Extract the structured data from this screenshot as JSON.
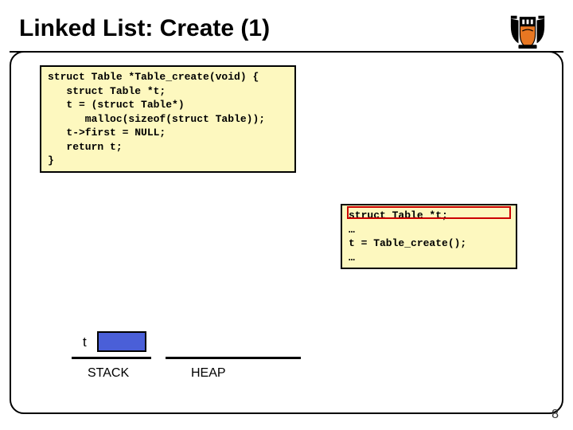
{
  "title": "Linked List: Create (1)",
  "code_main": "struct Table *Table_create(void) {\n   struct Table *t;\n   t = (struct Table*)\n      malloc(sizeof(struct Table));\n   t->first = NULL;\n   return t;\n}",
  "code_caller": "struct Table *t;\n…\nt = Table_create();\n…",
  "mem": {
    "var_label": "t",
    "stack_label": "STACK",
    "heap_label": "HEAP"
  },
  "page_number": "8",
  "shield_alt": "princeton-crest"
}
